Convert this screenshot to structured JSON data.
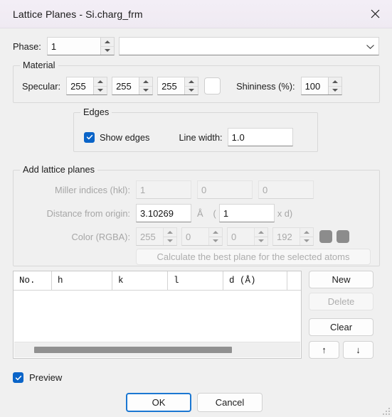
{
  "window": {
    "title": "Lattice Planes - Si.charg_frm",
    "close_icon": "close-icon"
  },
  "phase": {
    "label": "Phase:",
    "value": "1",
    "combo_value": "",
    "combo_placeholder": ""
  },
  "material": {
    "group_label": "Material",
    "specular_label": "Specular:",
    "specular": [
      "255",
      "255",
      "255"
    ],
    "swatch_color": "#ffffff",
    "shininess_label": "Shininess (%):",
    "shininess": "100"
  },
  "edges": {
    "group_label": "Edges",
    "show_edges_label": "Show edges",
    "show_edges_checked": true,
    "line_width_label": "Line width:",
    "line_width": "1.0"
  },
  "add_planes": {
    "group_label": "Add lattice planes",
    "miller_label": "Miller indices (hkl):",
    "miller": [
      "1",
      "0",
      "0"
    ],
    "distance_label": "Distance from origin:",
    "distance_value": "3.10269",
    "unit": "Å",
    "paren_open": "(",
    "multiplier": "1",
    "paren_close": "x d)",
    "color_label": "Color (RGBA):",
    "color_rgba": [
      "255",
      "0",
      "0",
      "192"
    ],
    "color_swatch_1": "#8c8c8c",
    "color_swatch_2": "#8c8c8c",
    "calculate_button": "Calculate the best plane for the selected atoms"
  },
  "table": {
    "columns": [
      "No.",
      "h",
      "k",
      "l",
      "d (Å)"
    ],
    "rows": []
  },
  "side_buttons": {
    "new_label": "New",
    "delete_label": "Delete",
    "clear_label": "Clear",
    "up_label": "↑",
    "down_label": "↓"
  },
  "footer": {
    "preview_label": "Preview",
    "preview_checked": true,
    "ok_label": "OK",
    "cancel_label": "Cancel"
  },
  "colors": {
    "accent": "#0a64c8",
    "focus_ring": "#1b77d2",
    "window_bg": "#f0f0f0",
    "titlebar": "#f2edf5"
  }
}
